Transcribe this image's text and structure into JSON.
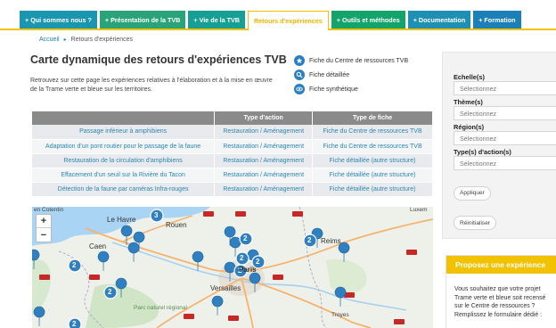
{
  "nav": {
    "tabs": [
      {
        "label": "+ Qui sommes nous ?",
        "color": "#1a96b0"
      },
      {
        "label": "+ Présentation de la TVB",
        "color": "#2aa37a"
      },
      {
        "label": "+ Vie de la TVB",
        "color": "#16a095"
      },
      {
        "label": "Retours d'expériences",
        "color": "#f2c200"
      },
      {
        "label": "+ Outils et méthodes",
        "color": "#12a46a"
      },
      {
        "label": "+ Documentation",
        "color": "#1f8fb3"
      },
      {
        "label": "+ Formation",
        "color": "#1b7fb8"
      }
    ]
  },
  "breadcrumb": {
    "home": "Accueil",
    "separator": "▸",
    "current": "Retours d'expériences"
  },
  "page": {
    "title": "Carte dynamique des retours d'expériences TVB",
    "intro": "Retrouvez sur cette page les expériences relatives à l'élaboration et à la mise en œuvre de la Trame verte et bleue sur les territoires."
  },
  "legend": [
    {
      "label": "Fiche du Centre de ressources TVB",
      "icon": "star-marker-icon"
    },
    {
      "label": "Fiche détaillée",
      "icon": "magnifier-marker-icon"
    },
    {
      "label": "Fiche synthétique",
      "icon": "eye-marker-icon"
    }
  ],
  "table": {
    "headers": [
      "",
      "Type d'action",
      "Type de fiche"
    ],
    "rows": [
      [
        "Passage inférieur à amphibiens",
        "Restauration / Aménagement",
        "Fiche du Centre de ressources TVB"
      ],
      [
        "Adaptation d'un pont routier pour le passage de la faune",
        "Restauration / Aménagement",
        "Fiche du Centre de ressources TVB"
      ],
      [
        "Restauration de la circulation d'amphibiens",
        "Restauration / Aménagement",
        "Fiche détaillée (autre structure)"
      ],
      [
        "Effacement d'un seuil sur la Rivière du Tacon",
        "Restauration / Aménagement",
        "Fiche détaillée (autre structure)"
      ],
      [
        "Détection de la faune par caméras Infra-rouges",
        "Restauration / Aménagement",
        "Fiche détaillée (autre structure)"
      ]
    ]
  },
  "map": {
    "zoom_in": "+",
    "zoom_out": "−",
    "labels": {
      "cotentin": "en Cotentin",
      "lehavre": "Le Havre",
      "rouen": "Rouen",
      "caen": "Caen",
      "paris": "Paris",
      "versailles": "Versailles",
      "reims": "Reims",
      "troyes": "Troyes",
      "luxem": "Luxem",
      "parc": "Parc naturel régional"
    },
    "clusters": [
      "3",
      "2",
      "2",
      "2",
      "2",
      "2",
      "2",
      "2",
      "2"
    ]
  },
  "filters": {
    "fields": [
      {
        "label": "Echelle(s)",
        "placeholder": "Sélectionnez"
      },
      {
        "label": "Thème(s)",
        "placeholder": "Sélectionnez"
      },
      {
        "label": "Région(s)",
        "placeholder": "Sélectionnez"
      },
      {
        "label": "Type(s) d'action(s)",
        "placeholder": "Sélectionnez"
      }
    ],
    "apply": "Appliquer",
    "reset": "Réinitialiser"
  },
  "propose": {
    "title": "Proposez une expérience",
    "body": "Vous souhaitez que votre projet Trame verte et bleue soit recensé sur le Centre de ressources ? Remplissez le formulaire dédié :"
  }
}
